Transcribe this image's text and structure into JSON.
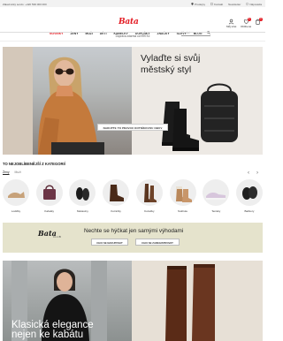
{
  "topbar": {
    "contact": "Zákaznický servis: +420 599 000 000",
    "links": [
      {
        "icon": "store-icon",
        "label": "Prodejny"
      },
      {
        "icon": "kontakt-icon",
        "label": "Kontakt"
      },
      {
        "icon": "newsletter-icon",
        "label": "Newsletter"
      },
      {
        "icon": "help-icon",
        "label": "Nápověda"
      }
    ]
  },
  "header": {
    "logo": "Bata",
    "account_label": "Můj účet",
    "wishlist_label": "Oblíbené",
    "cart_label": "Košík",
    "wishlist_count": "0",
    "cart_count": "0",
    "nav": [
      "NOVINKY",
      "ŽENY",
      "MUŽI",
      "DĚTI",
      "KABELKY",
      "DOPLŇKY",
      "ZNAČKY",
      "SLEVY",
      "BLOG"
    ],
    "search_placeholder": "Hledat",
    "shipping_note": "Doprava zdarma od 999 Kč"
  },
  "hero": {
    "headline_line1": "Vylaďte si svůj",
    "headline_line2": "městský styl",
    "cta": "NAKUPTE TO PRAVOU KOTNÍKOVOU OBUV"
  },
  "categories": {
    "title": "TO NEJOBLÍBENĚJŠÍ Z KATEGORIÍ",
    "tabs": [
      "Ženy",
      "Muži"
    ],
    "items": [
      {
        "label": "Lodičky",
        "icon": "pumps-icon"
      },
      {
        "label": "Kabelky",
        "icon": "handbag-icon"
      },
      {
        "label": "Mokasíny",
        "icon": "loafers-icon"
      },
      {
        "label": "Kotníčky",
        "icon": "ankle-boot-icon"
      },
      {
        "label": "Kozačky",
        "icon": "tall-boots-icon"
      },
      {
        "label": "Sněhule",
        "icon": "snow-boots-icon"
      },
      {
        "label": "Tenisky",
        "icon": "sneakers-icon"
      },
      {
        "label": "Bačkory",
        "icon": "slippers-icon"
      }
    ]
  },
  "club": {
    "logo": "Bata",
    "sub": "CLUB",
    "headline": "Nechte se hýčkat jen samými výhodami",
    "btn_primary": "CHCI SE NAKUPOVAT",
    "btn_secondary": "CHCI SE ZAREGISTROVAT"
  },
  "hero2": {
    "line1": "Klasická elegance",
    "line2": "nejen ke kabátu"
  },
  "colors": {
    "brand": "#e31b23",
    "club_band": "#e5e3cc"
  }
}
